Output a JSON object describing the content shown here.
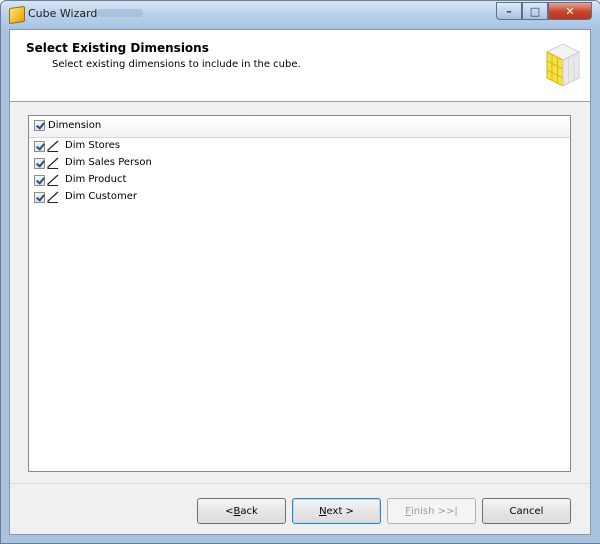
{
  "window": {
    "title": "Cube Wizard"
  },
  "header": {
    "title": "Select Existing Dimensions",
    "subtitle": "Select existing dimensions to include in the cube."
  },
  "list": {
    "column_header": "Dimension",
    "header_checked": true,
    "rows": [
      {
        "label": "Dim Stores",
        "checked": true
      },
      {
        "label": "Dim Sales Person",
        "checked": true
      },
      {
        "label": "Dim Product",
        "checked": true
      },
      {
        "label": "Dim Customer",
        "checked": true
      }
    ]
  },
  "buttons": {
    "back": {
      "mnemonic": "B",
      "before": "< ",
      "after": "ack"
    },
    "next": {
      "mnemonic": "N",
      "before": "",
      "after": "ext >"
    },
    "finish": {
      "mnemonic": "F",
      "before": "",
      "after": "inish >>|"
    },
    "cancel": "Cancel"
  },
  "colors": {
    "accent": "#3c7fb1",
    "titlebar": "#b9d0ea",
    "close": "#c7442b"
  }
}
